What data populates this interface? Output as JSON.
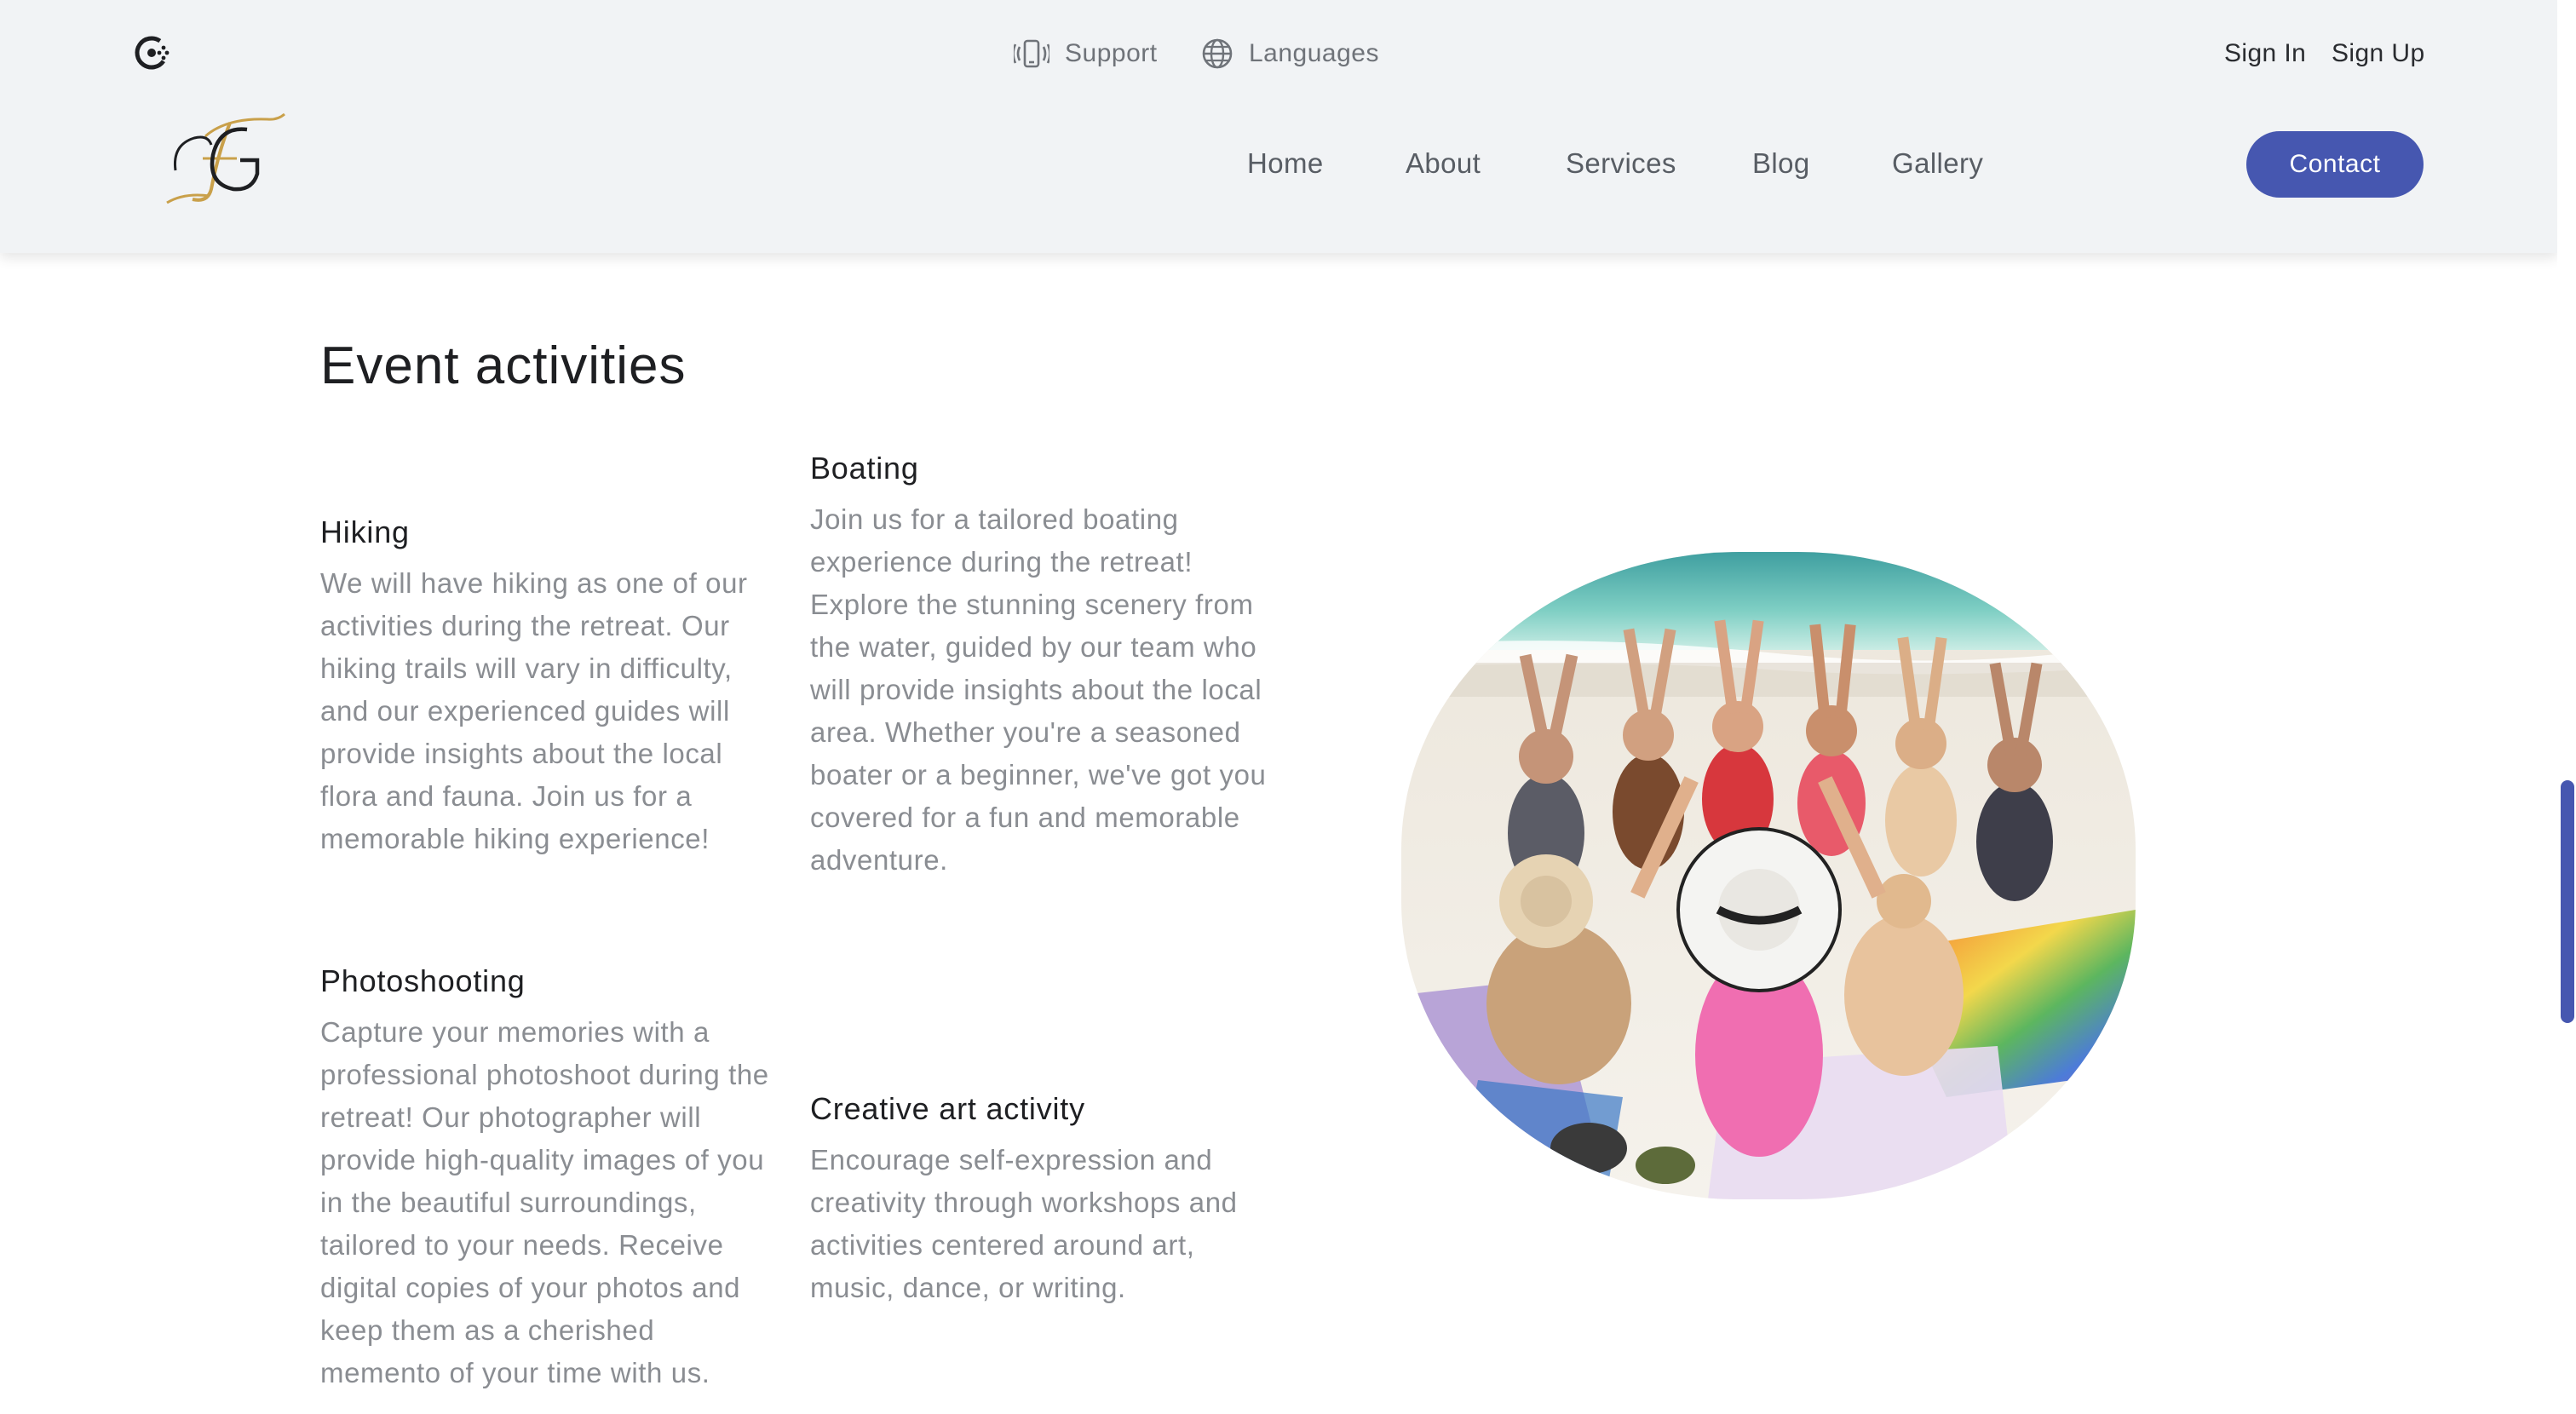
{
  "header": {
    "support_label": "Support",
    "languages_label": "Languages",
    "sign_in_label": "Sign In",
    "sign_up_label": "Sign Up",
    "nav": {
      "home": "Home",
      "about": "About",
      "services": "Services",
      "blog": "Blog",
      "gallery": "Gallery"
    },
    "contact_label": "Contact",
    "brand_monogram": "FG",
    "colors": {
      "accent": "#4657b0",
      "gold": "#c9a04a",
      "header_bg": "#f1f3f5"
    }
  },
  "main": {
    "title": "Event activities",
    "activities": {
      "hiking": {
        "title": "Hiking",
        "text": "We will have hiking as one of our activities during the retreat. Our hiking trails will vary in difficulty, and our experienced guides will provide insights about the local flora and fauna. Join us for a memorable hiking experience!"
      },
      "boating": {
        "title": "Boating",
        "text": "Join us for a tailored boating experience during the retreat! Explore the stunning scenery from the water, guided by our team who will provide insights about the local area. Whether you're a seasoned boater or a beginner, we've got you covered for a fun and memorable adventure."
      },
      "photoshooting": {
        "title": "Photoshooting",
        "text": "Capture your memories with a professional photoshoot during the retreat! Our photographer will provide high-quality images of you in the beautiful surroundings, tailored to your needs. Receive digital copies of your photos and keep them as a cherished memento of your time with us."
      },
      "creative": {
        "title": "Creative art activity",
        "text": "Encourage self-expression and creativity through workshops and activities centered around art, music, dance, or writing."
      }
    }
  }
}
